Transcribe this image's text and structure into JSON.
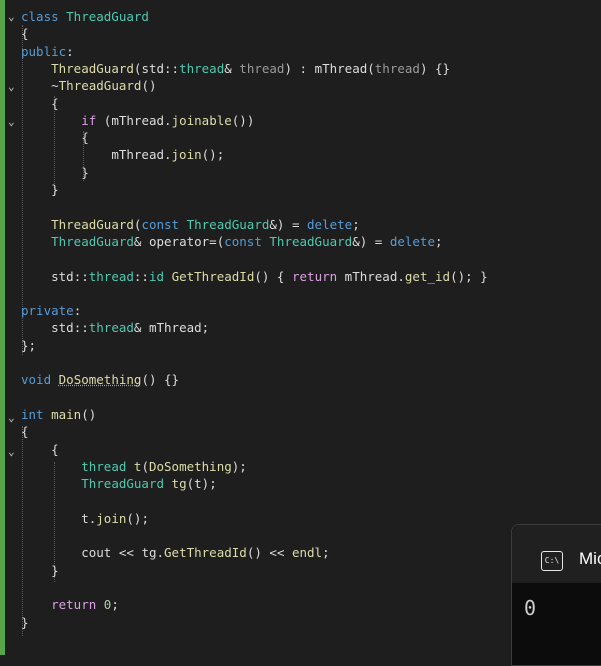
{
  "editor": {
    "lines": [
      {
        "tokens": [
          {
            "t": "class ",
            "c": "kw"
          },
          {
            "t": "ThreadGuard",
            "c": "ty"
          }
        ]
      },
      {
        "tokens": [
          {
            "t": "{",
            "c": ""
          }
        ]
      },
      {
        "tokens": [
          {
            "t": "public",
            "c": "kw"
          },
          {
            "t": ":",
            "c": ""
          }
        ]
      },
      {
        "tokens": [
          {
            "t": "    ",
            "c": ""
          },
          {
            "t": "ThreadGuard",
            "c": "fn"
          },
          {
            "t": "(",
            "c": ""
          },
          {
            "t": "std",
            "c": "ns"
          },
          {
            "t": "::",
            "c": ""
          },
          {
            "t": "thread",
            "c": "ty"
          },
          {
            "t": "& ",
            "c": ""
          },
          {
            "t": "thread",
            "c": "pm"
          },
          {
            "t": ") : ",
            "c": ""
          },
          {
            "t": "mThread",
            "c": ""
          },
          {
            "t": "(",
            "c": ""
          },
          {
            "t": "thread",
            "c": "pm"
          },
          {
            "t": ") {}",
            "c": ""
          }
        ]
      },
      {
        "tokens": [
          {
            "t": "    ~",
            "c": ""
          },
          {
            "t": "ThreadGuard",
            "c": "fn"
          },
          {
            "t": "()",
            "c": ""
          }
        ]
      },
      {
        "tokens": [
          {
            "t": "    {",
            "c": ""
          }
        ]
      },
      {
        "tokens": [
          {
            "t": "        ",
            "c": ""
          },
          {
            "t": "if",
            "c": "ctl"
          },
          {
            "t": " (",
            "c": ""
          },
          {
            "t": "mThread",
            "c": ""
          },
          {
            "t": ".",
            "c": ""
          },
          {
            "t": "joinable",
            "c": "fn"
          },
          {
            "t": "())",
            "c": ""
          }
        ]
      },
      {
        "tokens": [
          {
            "t": "        {",
            "c": ""
          }
        ]
      },
      {
        "tokens": [
          {
            "t": "            ",
            "c": ""
          },
          {
            "t": "mThread",
            "c": ""
          },
          {
            "t": ".",
            "c": ""
          },
          {
            "t": "join",
            "c": "fn"
          },
          {
            "t": "();",
            "c": ""
          }
        ]
      },
      {
        "tokens": [
          {
            "t": "        }",
            "c": ""
          }
        ]
      },
      {
        "tokens": [
          {
            "t": "    }",
            "c": ""
          }
        ]
      },
      {
        "tokens": []
      },
      {
        "tokens": [
          {
            "t": "    ",
            "c": ""
          },
          {
            "t": "ThreadGuard",
            "c": "fn"
          },
          {
            "t": "(",
            "c": ""
          },
          {
            "t": "const ",
            "c": "kw"
          },
          {
            "t": "ThreadGuard",
            "c": "ty"
          },
          {
            "t": "&) = ",
            "c": ""
          },
          {
            "t": "delete",
            "c": "kw"
          },
          {
            "t": ";",
            "c": ""
          }
        ]
      },
      {
        "tokens": [
          {
            "t": "    ",
            "c": ""
          },
          {
            "t": "ThreadGuard",
            "c": "ty"
          },
          {
            "t": "& ",
            "c": ""
          },
          {
            "t": "operator=",
            "c": ""
          },
          {
            "t": "(",
            "c": ""
          },
          {
            "t": "const ",
            "c": "kw"
          },
          {
            "t": "ThreadGuard",
            "c": "ty"
          },
          {
            "t": "&) = ",
            "c": ""
          },
          {
            "t": "delete",
            "c": "kw"
          },
          {
            "t": ";",
            "c": ""
          }
        ]
      },
      {
        "tokens": []
      },
      {
        "tokens": [
          {
            "t": "    ",
            "c": ""
          },
          {
            "t": "std",
            "c": "ns"
          },
          {
            "t": "::",
            "c": ""
          },
          {
            "t": "thread",
            "c": "ty"
          },
          {
            "t": "::",
            "c": ""
          },
          {
            "t": "id",
            "c": "ty"
          },
          {
            "t": " ",
            "c": ""
          },
          {
            "t": "GetThreadId",
            "c": "fn"
          },
          {
            "t": "() { ",
            "c": ""
          },
          {
            "t": "return",
            "c": "ctl"
          },
          {
            "t": " mThread",
            "c": ""
          },
          {
            "t": ".",
            "c": ""
          },
          {
            "t": "get_id",
            "c": "fn"
          },
          {
            "t": "(); }",
            "c": ""
          }
        ]
      },
      {
        "tokens": []
      },
      {
        "tokens": [
          {
            "t": "private",
            "c": "kw"
          },
          {
            "t": ":",
            "c": ""
          }
        ]
      },
      {
        "tokens": [
          {
            "t": "    ",
            "c": ""
          },
          {
            "t": "std",
            "c": "ns"
          },
          {
            "t": "::",
            "c": ""
          },
          {
            "t": "thread",
            "c": "ty"
          },
          {
            "t": "& ",
            "c": ""
          },
          {
            "t": "mThread",
            "c": ""
          },
          {
            "t": ";",
            "c": ""
          }
        ]
      },
      {
        "tokens": [
          {
            "t": "};",
            "c": ""
          }
        ]
      },
      {
        "tokens": []
      },
      {
        "tokens": [
          {
            "t": "void ",
            "c": "kw"
          },
          {
            "t": "DoSomething",
            "c": "fn squig"
          },
          {
            "t": "() {}",
            "c": ""
          }
        ]
      },
      {
        "tokens": []
      },
      {
        "tokens": [
          {
            "t": "int ",
            "c": "kw"
          },
          {
            "t": "main",
            "c": "fn"
          },
          {
            "t": "()",
            "c": ""
          }
        ]
      },
      {
        "tokens": [
          {
            "t": "{",
            "c": ""
          }
        ]
      },
      {
        "tokens": [
          {
            "t": "    {",
            "c": ""
          }
        ]
      },
      {
        "tokens": [
          {
            "t": "        ",
            "c": ""
          },
          {
            "t": "thread",
            "c": "ty"
          },
          {
            "t": " ",
            "c": ""
          },
          {
            "t": "t",
            "c": "fn"
          },
          {
            "t": "(",
            "c": ""
          },
          {
            "t": "DoSomething",
            "c": "fn"
          },
          {
            "t": ");",
            "c": ""
          }
        ]
      },
      {
        "tokens": [
          {
            "t": "        ",
            "c": ""
          },
          {
            "t": "ThreadGuard",
            "c": "ty"
          },
          {
            "t": " ",
            "c": ""
          },
          {
            "t": "tg",
            "c": "fn"
          },
          {
            "t": "(",
            "c": ""
          },
          {
            "t": "t",
            "c": ""
          },
          {
            "t": ");",
            "c": ""
          }
        ]
      },
      {
        "tokens": []
      },
      {
        "tokens": [
          {
            "t": "        ",
            "c": ""
          },
          {
            "t": "t",
            "c": ""
          },
          {
            "t": ".",
            "c": ""
          },
          {
            "t": "join",
            "c": "fn"
          },
          {
            "t": "();",
            "c": ""
          }
        ]
      },
      {
        "tokens": []
      },
      {
        "tokens": [
          {
            "t": "        ",
            "c": ""
          },
          {
            "t": "cout",
            "c": ""
          },
          {
            "t": " << ",
            "c": ""
          },
          {
            "t": "tg",
            "c": ""
          },
          {
            "t": ".",
            "c": ""
          },
          {
            "t": "GetThreadId",
            "c": "fn"
          },
          {
            "t": "() << ",
            "c": ""
          },
          {
            "t": "endl",
            "c": "fn"
          },
          {
            "t": ";",
            "c": ""
          }
        ]
      },
      {
        "tokens": [
          {
            "t": "    }",
            "c": ""
          }
        ]
      },
      {
        "tokens": []
      },
      {
        "tokens": [
          {
            "t": "    ",
            "c": ""
          },
          {
            "t": "return",
            "c": "ctl"
          },
          {
            "t": " ",
            "c": ""
          },
          {
            "t": "0",
            "c": "num"
          },
          {
            "t": ";",
            "c": ""
          }
        ]
      },
      {
        "tokens": [
          {
            "t": "}",
            "c": ""
          }
        ]
      }
    ],
    "fold_markers": [
      "⌄",
      "⌄",
      "⌄",
      "⌄",
      "⌄"
    ]
  },
  "console": {
    "icon_text": "C:\\",
    "title": "Mic",
    "output": "0"
  }
}
